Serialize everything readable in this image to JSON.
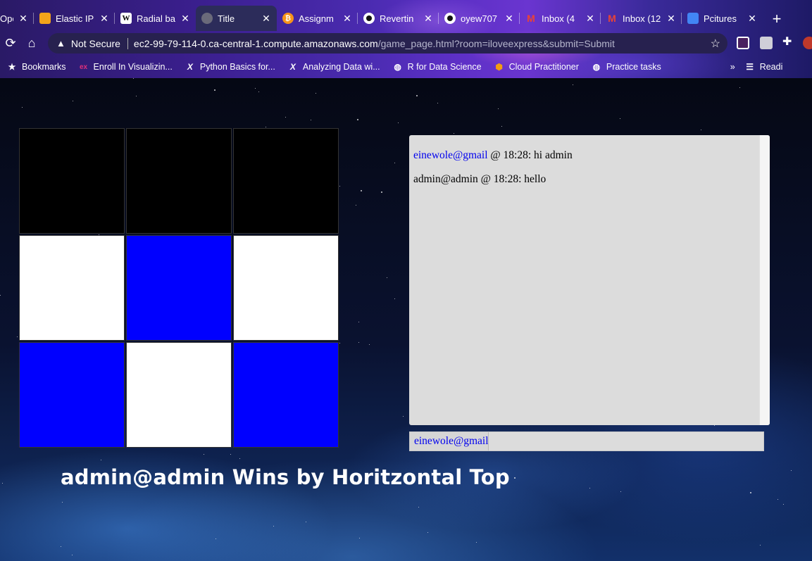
{
  "browser": {
    "tabs": [
      {
        "label": "Ope",
        "icon": "generic-icon"
      },
      {
        "label": "Elastic IP",
        "icon": "aws-icon"
      },
      {
        "label": "Radial ba",
        "icon": "wikipedia-icon"
      },
      {
        "label": "Title",
        "icon": "globe-icon",
        "active": true
      },
      {
        "label": "Assignm",
        "icon": "bitcoin-icon"
      },
      {
        "label": "Revertin",
        "icon": "github-icon"
      },
      {
        "label": "oyew707",
        "icon": "github-icon"
      },
      {
        "label": "Inbox (4",
        "icon": "gmail-icon"
      },
      {
        "label": "Inbox (12",
        "icon": "gmail-icon"
      },
      {
        "label": "Pcitures",
        "icon": "docs-icon"
      }
    ],
    "address": {
      "security": "Not Secure",
      "host": "ec2-99-79-114-0.ca-central-1.compute.amazonaws.com",
      "path": "/game_page.html?room=iloveexpress&submit=Submit"
    },
    "bookmarks": [
      {
        "label": "Bookmarks",
        "icon": "star-icon"
      },
      {
        "label": "Enroll In Visualizin...",
        "icon": "edx-icon"
      },
      {
        "label": "Python Basics for...",
        "icon": "x-icon"
      },
      {
        "label": "Analyzing Data wi...",
        "icon": "x-icon"
      },
      {
        "label": "R for Data Science",
        "icon": "globe-icon"
      },
      {
        "label": "Cloud Practitioner",
        "icon": "aws-icon"
      },
      {
        "label": "Practice tasks",
        "icon": "globe-icon"
      }
    ],
    "reading_list_label": "Readi"
  },
  "board": {
    "cells": [
      "black",
      "black",
      "black",
      "white",
      "blue",
      "white",
      "blue",
      "white",
      "blue"
    ],
    "colors": {
      "black": "#000000",
      "white": "#ffffff",
      "blue": "#0000ff"
    }
  },
  "chat": {
    "messages": [
      {
        "user": "einewole@gmail",
        "is_link": true,
        "text": " @ 18:28: hi admin"
      },
      {
        "user": "admin@admin",
        "is_link": false,
        "text": " @ 18:28: hello"
      }
    ],
    "input_user": "einewole@gmail",
    "input_value": ""
  },
  "result": {
    "text": "admin@admin Wins by Horitzontal Top"
  }
}
